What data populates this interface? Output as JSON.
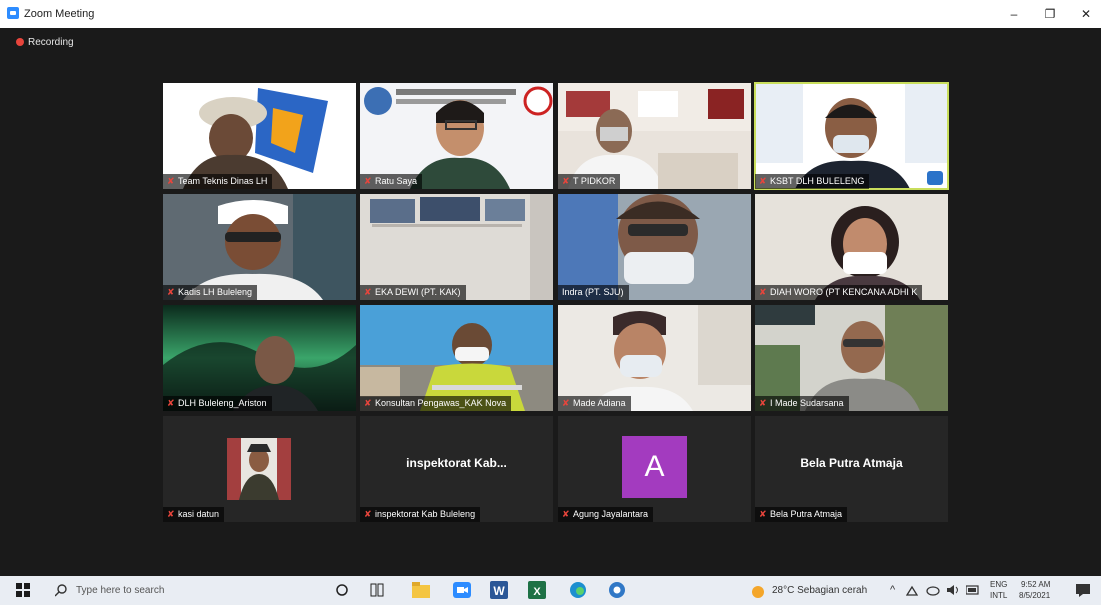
{
  "window": {
    "title": "Zoom Meeting",
    "minimize_glyph": "–",
    "restore_glyph": "❐",
    "close_glyph": "✕"
  },
  "recording": {
    "label": "Recording"
  },
  "participants": [
    {
      "name": "Team Teknis Dinas LH"
    },
    {
      "name": "Ratu Saya"
    },
    {
      "name": "T PIDKOR"
    },
    {
      "name": "KSBT DLH BULELENG"
    },
    {
      "name": "Kadis LH Buleleng"
    },
    {
      "name": "EKA DEWI (PT. KAK)"
    },
    {
      "name": "Indra (PT. SJU)"
    },
    {
      "name": "DIAH WORO (PT KENCANA ADHI K"
    },
    {
      "name": "DLH Buleleng_Ariston"
    },
    {
      "name": "Konsultan Pengawas_KAK Nova"
    },
    {
      "name": "Made Adiana"
    },
    {
      "name": "I Made Sudarsana"
    },
    {
      "name": "kasi datun"
    },
    {
      "name": "inspektorat Kab Buleleng",
      "display": "inspektorat Kab..."
    },
    {
      "name": "Agung Jayalantara",
      "initial": "A"
    },
    {
      "name": "Bela Putra Atmaja",
      "display": "Bela Putra Atmaja"
    }
  ],
  "taskbar": {
    "search_placeholder": "Type here to search",
    "weather": "28°C  Sebagian cerah",
    "lang_top": "ENG",
    "lang_bottom": "INTL",
    "time": "9:52 AM",
    "date": "8/5/2021"
  }
}
